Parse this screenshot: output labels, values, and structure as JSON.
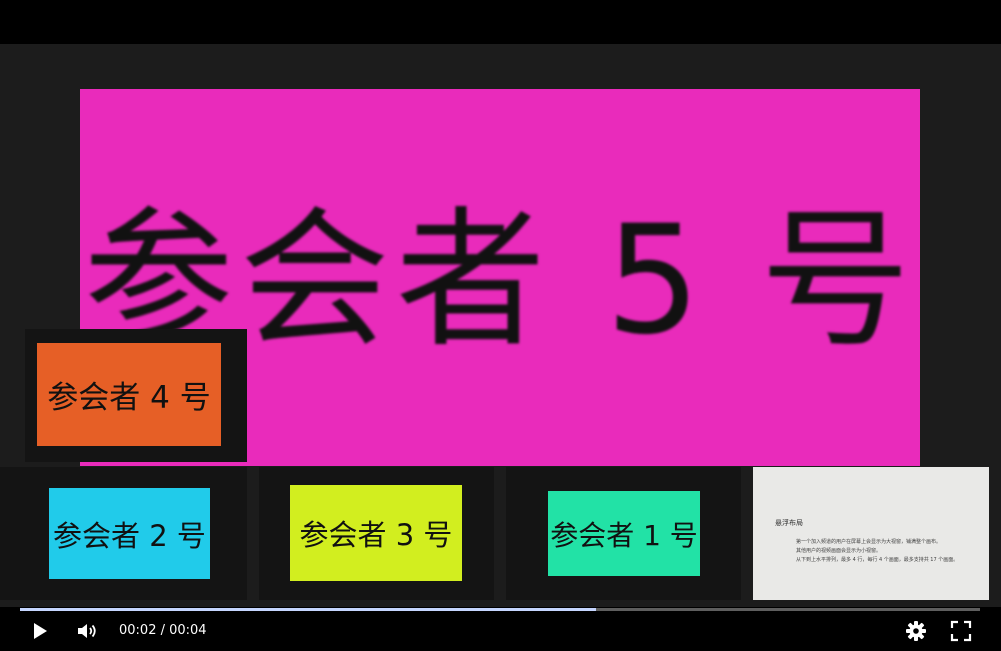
{
  "video": {
    "tiles": {
      "main": "参会者 5 号",
      "p4": "参会者 4 号",
      "p2": "参会者 2 号",
      "p3": "参会者 3 号",
      "p1": "参会者 1 号"
    },
    "doc": {
      "title": "悬浮布局",
      "lines": [
        "第一个加入频道的用户在屏幕上会显示为大视窗，铺满整个画布。",
        "其他用户的视频画面会显示为小视窗。",
        "从下到上水平排列，最多 4 行，每行 4 个画面，最多支持共 17 个画面。"
      ]
    }
  },
  "player": {
    "time_display": "00:02 / 00:04",
    "progress_fraction": 0.6,
    "icons": {
      "play": "play-icon",
      "volume": "volume-icon",
      "settings": "gear-icon",
      "fullscreen": "fullscreen-icon"
    }
  }
}
